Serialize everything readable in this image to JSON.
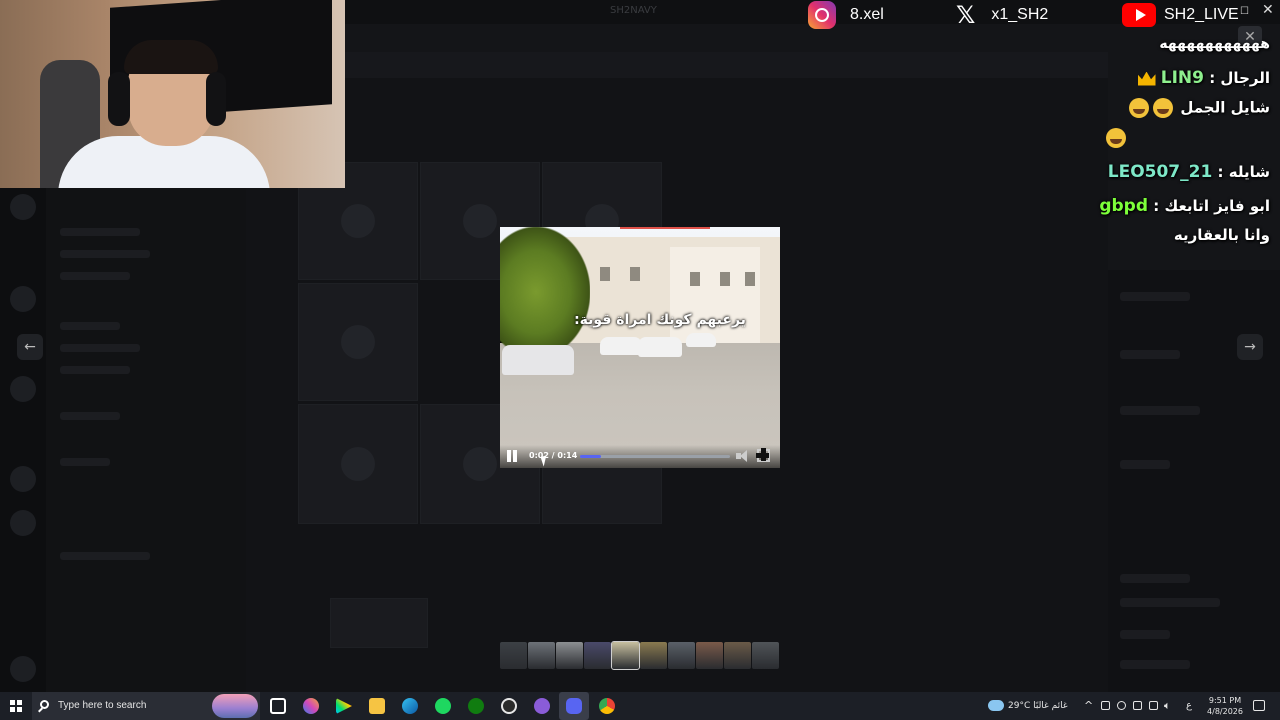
{
  "background_app": {
    "window_title": "SH2NAVY"
  },
  "webcam": {
    "description_icon": "webcam-feed"
  },
  "socials": {
    "instagram": {
      "handle": "8.xel",
      "icon": "instagram-icon"
    },
    "x": {
      "handle": "x1_SH2",
      "icon": "x-icon"
    },
    "youtube": {
      "handle": "SH2_LIVE",
      "icon": "youtube-icon"
    }
  },
  "chat": {
    "messages": [
      {
        "user": "",
        "text": "هههههههههههه"
      },
      {
        "user": "LIN9",
        "text": "الرجال",
        "badge": "crown-icon"
      },
      {
        "user": "",
        "text": "شايل الجمل"
      },
      {
        "user": "LEO507_21",
        "text": "شايله"
      },
      {
        "user": "gbpd",
        "text": "ابو فايز اتابعك"
      },
      {
        "user": "",
        "text": "وانا بالعقاريه"
      }
    ],
    "user_colors": {
      "LIN9": "#8ef08e",
      "LEO507_21": "#7ee8c8",
      "gbpd": "#7dff3a"
    }
  },
  "viewer": {
    "prev_label": "←",
    "next_label": "→",
    "close_label": "✕"
  },
  "video": {
    "caption": "يرعبهم كونك امراة قوية:",
    "time_current": "0:02",
    "time_total": "0:14",
    "time_display": "0:02 / 0:14",
    "progress": 0.14,
    "accent_color": "#5865f2"
  },
  "thumbnails": {
    "count": 10
  },
  "taskbar": {
    "search_placeholder": "Type here to search",
    "weather": "29°C  غائم غالبًا",
    "language": "ع",
    "time": "9:51 PM",
    "date": "4/8/2026"
  }
}
